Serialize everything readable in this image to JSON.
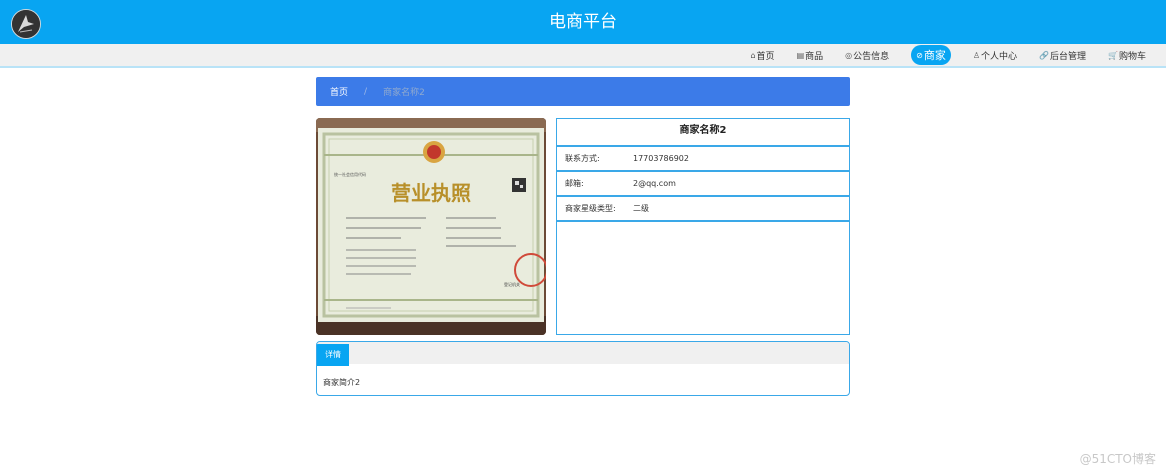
{
  "header": {
    "title": "电商平台",
    "logo_icon": "logo-icon"
  },
  "nav": {
    "items": [
      {
        "name": "nav-home",
        "icon": "⌂",
        "label": "首页",
        "active": false
      },
      {
        "name": "nav-products",
        "icon": "▤",
        "label": "商品",
        "active": false
      },
      {
        "name": "nav-announcements",
        "icon": "◎",
        "label": "公告信息",
        "active": false
      },
      {
        "name": "nav-merchants",
        "icon": "⊘",
        "label": "商家",
        "active": true
      },
      {
        "name": "nav-personal-center",
        "icon": "♙",
        "label": "个人中心",
        "active": false
      },
      {
        "name": "nav-admin",
        "icon": "🔗",
        "label": "后台管理",
        "active": false
      },
      {
        "name": "nav-cart",
        "icon": "🛒",
        "label": "购物车",
        "active": false
      }
    ]
  },
  "breadcrumb": {
    "home": "首页",
    "separator": "/",
    "current": "商家名称2"
  },
  "merchant": {
    "name": "商家名称2",
    "license_image": {
      "title": "营业执照",
      "top_left": "统一社会信用代码",
      "seal_text": "登记机关"
    },
    "fields": [
      {
        "label": "联系方式:",
        "value": "17703786902"
      },
      {
        "label": "邮箱:",
        "value": "2@qq.com"
      },
      {
        "label": "商家星级类型:",
        "value": "二级"
      }
    ]
  },
  "detail": {
    "tab_label": "详情",
    "content": "商家简介2"
  },
  "watermark": "@51CTO博客",
  "colors": {
    "primary": "#08a5f2",
    "breadcrumb": "#3c7be8",
    "border": "#3aa8e8"
  }
}
